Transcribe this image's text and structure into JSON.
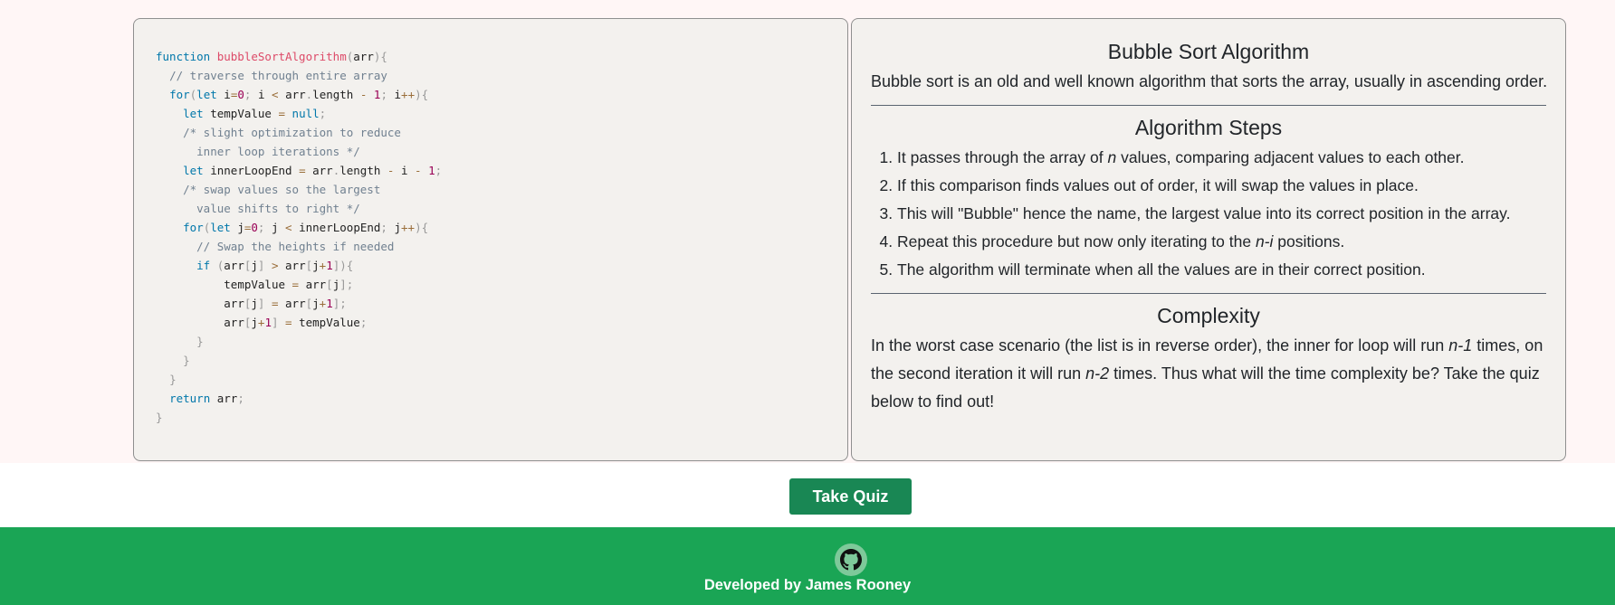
{
  "code": {
    "lines": [
      [
        [
          "kw",
          "function "
        ],
        [
          "fn",
          "bubbleSortAlgorithm"
        ],
        [
          "pn",
          "("
        ],
        [
          "",
          "arr"
        ],
        [
          "pn",
          "){"
        ]
      ],
      [
        [
          "",
          "  "
        ],
        [
          "cm",
          "// traverse through entire array"
        ]
      ],
      [
        [
          "",
          "  "
        ],
        [
          "kw",
          "for"
        ],
        [
          "pn",
          "("
        ],
        [
          "kw",
          "let "
        ],
        [
          "",
          "i"
        ],
        [
          "op",
          "="
        ],
        [
          "num",
          "0"
        ],
        [
          "pn",
          "; "
        ],
        [
          "",
          "i "
        ],
        [
          "op",
          "< "
        ],
        [
          "",
          "arr"
        ],
        [
          "pn",
          "."
        ],
        [
          "",
          "length "
        ],
        [
          "op",
          "- "
        ],
        [
          "num",
          "1"
        ],
        [
          "pn",
          "; "
        ],
        [
          "",
          "i"
        ],
        [
          "op",
          "++"
        ],
        [
          "pn",
          "){"
        ]
      ],
      [
        [
          "",
          "    "
        ],
        [
          "kw",
          "let "
        ],
        [
          "",
          "tempValue "
        ],
        [
          "op",
          "= "
        ],
        [
          "kw",
          "null"
        ],
        [
          "pn",
          ";"
        ]
      ],
      [
        [
          "",
          "    "
        ],
        [
          "cm",
          "/* slight optimization to reduce"
        ]
      ],
      [
        [
          "",
          "      "
        ],
        [
          "cm",
          "inner loop iterations */"
        ]
      ],
      [
        [
          "",
          "    "
        ],
        [
          "kw",
          "let "
        ],
        [
          "",
          "innerLoopEnd "
        ],
        [
          "op",
          "= "
        ],
        [
          "",
          "arr"
        ],
        [
          "pn",
          "."
        ],
        [
          "",
          "length "
        ],
        [
          "op",
          "- "
        ],
        [
          "",
          "i "
        ],
        [
          "op",
          "- "
        ],
        [
          "num",
          "1"
        ],
        [
          "pn",
          ";"
        ]
      ],
      [
        [
          "",
          "    "
        ],
        [
          "cm",
          "/* swap values so the largest"
        ]
      ],
      [
        [
          "",
          "      "
        ],
        [
          "cm",
          "value shifts to right */"
        ]
      ],
      [
        [
          "",
          "    "
        ],
        [
          "kw",
          "for"
        ],
        [
          "pn",
          "("
        ],
        [
          "kw",
          "let "
        ],
        [
          "",
          "j"
        ],
        [
          "op",
          "="
        ],
        [
          "num",
          "0"
        ],
        [
          "pn",
          "; "
        ],
        [
          "",
          "j "
        ],
        [
          "op",
          "< "
        ],
        [
          "",
          "innerLoopEnd"
        ],
        [
          "pn",
          "; "
        ],
        [
          "",
          "j"
        ],
        [
          "op",
          "++"
        ],
        [
          "pn",
          "){"
        ]
      ],
      [
        [
          "",
          "      "
        ],
        [
          "cm",
          "// Swap the heights if needed"
        ]
      ],
      [
        [
          "",
          "      "
        ],
        [
          "kw",
          "if "
        ],
        [
          "pn",
          "("
        ],
        [
          "",
          "arr"
        ],
        [
          "pn",
          "["
        ],
        [
          "",
          "j"
        ],
        [
          "pn",
          "] "
        ],
        [
          "op",
          "> "
        ],
        [
          "",
          "arr"
        ],
        [
          "pn",
          "["
        ],
        [
          "",
          "j"
        ],
        [
          "op",
          "+"
        ],
        [
          "num",
          "1"
        ],
        [
          "pn",
          "]){"
        ]
      ],
      [
        [
          "",
          "          "
        ],
        [
          "",
          "tempValue "
        ],
        [
          "op",
          "= "
        ],
        [
          "",
          "arr"
        ],
        [
          "pn",
          "["
        ],
        [
          "",
          "j"
        ],
        [
          "pn",
          "];"
        ]
      ],
      [
        [
          "",
          "          "
        ],
        [
          "",
          "arr"
        ],
        [
          "pn",
          "["
        ],
        [
          "",
          "j"
        ],
        [
          "pn",
          "] "
        ],
        [
          "op",
          "= "
        ],
        [
          "",
          "arr"
        ],
        [
          "pn",
          "["
        ],
        [
          "",
          "j"
        ],
        [
          "op",
          "+"
        ],
        [
          "num",
          "1"
        ],
        [
          "pn",
          "];"
        ]
      ],
      [
        [
          "",
          "          "
        ],
        [
          "",
          "arr"
        ],
        [
          "pn",
          "["
        ],
        [
          "",
          "j"
        ],
        [
          "op",
          "+"
        ],
        [
          "num",
          "1"
        ],
        [
          "pn",
          "] "
        ],
        [
          "op",
          "= "
        ],
        [
          "",
          "tempValue"
        ],
        [
          "pn",
          ";"
        ]
      ],
      [
        [
          "",
          "      "
        ],
        [
          "pn",
          "}"
        ]
      ],
      [
        [
          "",
          "    "
        ],
        [
          "pn",
          "}"
        ]
      ],
      [
        [
          "",
          "  "
        ],
        [
          "pn",
          "}"
        ]
      ],
      [
        [
          "",
          "  "
        ],
        [
          "kw",
          "return "
        ],
        [
          "",
          "arr"
        ],
        [
          "pn",
          ";"
        ]
      ],
      [
        [
          "pn",
          "}"
        ]
      ]
    ]
  },
  "info": {
    "title": "Bubble Sort Algorithm",
    "intro": "Bubble sort is an old and well known algorithm that sorts the array, usually in ascending order.",
    "steps_title": "Algorithm Steps",
    "steps": [
      [
        [
          "",
          "It passes through the array of "
        ],
        [
          "i",
          "n"
        ],
        [
          "",
          " values, comparing adjacent values to each other."
        ]
      ],
      [
        [
          "",
          "If this comparison finds values out of order, it will swap the values in place."
        ]
      ],
      [
        [
          "",
          "This will \"Bubble\" hence the name, the largest value into its correct position in the array."
        ]
      ],
      [
        [
          "",
          "Repeat this procedure but now only iterating to the "
        ],
        [
          "i",
          "n-i"
        ],
        [
          "",
          " positions."
        ]
      ],
      [
        [
          "",
          "The algorithm will terminate when all the values are in their correct position."
        ]
      ]
    ],
    "complexity_title": "Complexity",
    "complexity": [
      [
        "",
        "In the worst case scenario (the list is in reverse order), the inner for loop will run "
      ],
      [
        "i",
        "n-1"
      ],
      [
        "",
        " times, on the second iteration it will run "
      ],
      [
        "i",
        "n-2"
      ],
      [
        "",
        " times. Thus what will the time complexity be? Take the quiz below to find out!"
      ]
    ]
  },
  "quiz_button": "Take Quiz",
  "footer": {
    "icon": "github-icon",
    "text": "Developed by James Rooney"
  },
  "colors": {
    "button": "#198754",
    "footer": "#1aa555",
    "panel": "#f3f1ee"
  }
}
